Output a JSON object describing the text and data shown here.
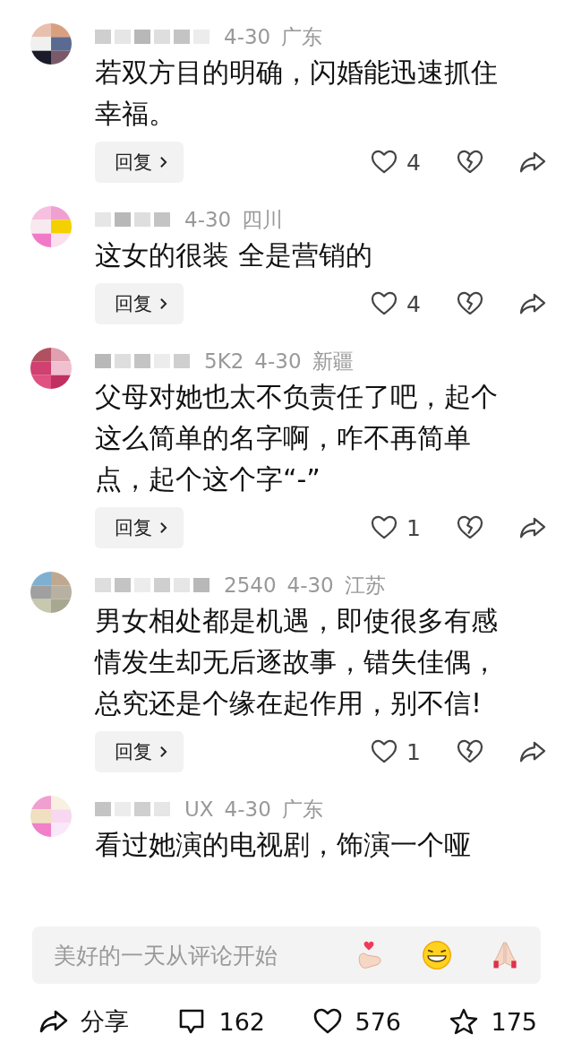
{
  "comments": [
    {
      "date": "4-30",
      "region": "广东",
      "text": "若双方目的明确，闪婚能迅速抓住幸福。",
      "reply": "回复",
      "likes": "4"
    },
    {
      "date": "4-30",
      "region": "四川",
      "text": "这女的很装 全是营销的",
      "reply": "回复",
      "likes": "4"
    },
    {
      "name_tail": "5K2",
      "date": "4-30",
      "region": "新疆",
      "text": "父母对她也太不负责任了吧，起个这么简单的名字啊，咋不再简单点，起个这个字“-”",
      "reply": "回复",
      "likes": "1"
    },
    {
      "name_tail": "2540",
      "date": "4-30",
      "region": "江苏",
      "text": "男女相处都是机遇，即使很多有感情发生却无后逐故事，错失佳偶，总究还是个缘在起作用，别不信!",
      "reply": "回复",
      "likes": "1"
    },
    {
      "name_tail": "UX",
      "date": "4-30",
      "region": "广东",
      "text": "看过她演的电视剧，饰演一个哑"
    }
  ],
  "comment_input": {
    "placeholder": "美好的一天从评论开始"
  },
  "toolbar": [
    {
      "kind": "share",
      "label": "分享"
    },
    {
      "kind": "comment",
      "label": "162"
    },
    {
      "kind": "like",
      "label": "576"
    },
    {
      "kind": "star",
      "label": "175"
    }
  ]
}
